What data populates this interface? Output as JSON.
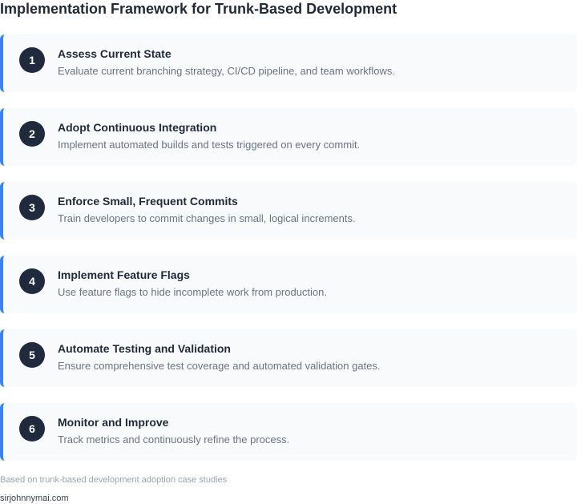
{
  "title": "Implementation Framework for Trunk-Based Development",
  "steps": [
    {
      "number": "1",
      "title": "Assess Current State",
      "description": "Evaluate current branching strategy, CI/CD pipeline, and team workflows."
    },
    {
      "number": "2",
      "title": "Adopt Continuous Integration",
      "description": "Implement automated builds and tests triggered on every commit."
    },
    {
      "number": "3",
      "title": "Enforce Small, Frequent Commits",
      "description": "Train developers to commit changes in small, logical increments."
    },
    {
      "number": "4",
      "title": "Implement Feature Flags",
      "description": "Use feature flags to hide incomplete work from production."
    },
    {
      "number": "5",
      "title": "Automate Testing and Validation",
      "description": "Ensure comprehensive test coverage and automated validation gates."
    },
    {
      "number": "6",
      "title": "Monitor and Improve",
      "description": "Track metrics and continuously refine the process."
    }
  ],
  "footer": {
    "note": "Based on trunk-based development adoption case studies",
    "credit": "sirjohnnymai.com"
  },
  "colors": {
    "accent": "#3b82f6",
    "badge": "#1f2b3d",
    "card_background": "#f8fafc"
  }
}
